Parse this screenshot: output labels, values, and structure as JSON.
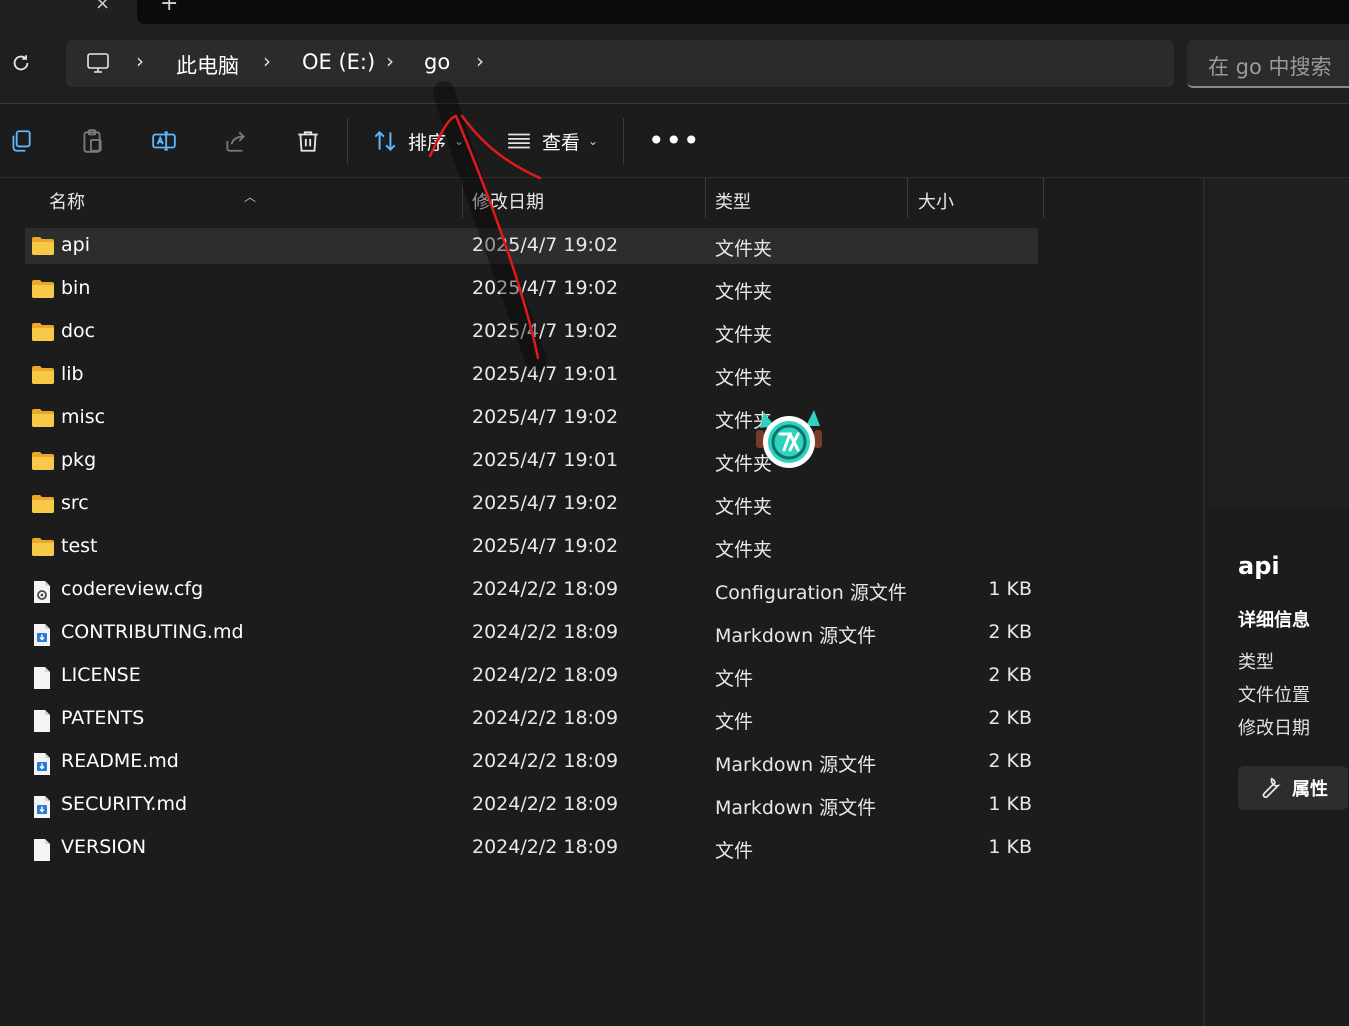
{
  "tabstrip": {
    "close_glyph": "×",
    "add_glyph": "+"
  },
  "navbar": {
    "breadcrumb": [
      "此电脑",
      "OE (E:)",
      "go"
    ],
    "search_placeholder": "在 go 中搜索"
  },
  "toolbar": {
    "sort_label": "排序",
    "view_label": "查看",
    "more_label": "•••",
    "icons": [
      "copy-icon",
      "paste-icon",
      "rename-icon",
      "share-icon",
      "delete-icon",
      "sort-icon",
      "view-icon",
      "more-icon"
    ]
  },
  "columns": {
    "name": "名称",
    "modified": "修改日期",
    "type": "类型",
    "size": "大小"
  },
  "files": [
    {
      "name": "api",
      "date": "2025/4/7 19:02",
      "type": "文件夹",
      "size": "",
      "icon": "folder-icon"
    },
    {
      "name": "bin",
      "date": "2025/4/7 19:02",
      "type": "文件夹",
      "size": "",
      "icon": "folder-icon"
    },
    {
      "name": "doc",
      "date": "2025/4/7 19:02",
      "type": "文件夹",
      "size": "",
      "icon": "folder-icon"
    },
    {
      "name": "lib",
      "date": "2025/4/7 19:01",
      "type": "文件夹",
      "size": "",
      "icon": "folder-icon"
    },
    {
      "name": "misc",
      "date": "2025/4/7 19:02",
      "type": "文件夹",
      "size": "",
      "icon": "folder-icon"
    },
    {
      "name": "pkg",
      "date": "2025/4/7 19:01",
      "type": "文件夹",
      "size": "",
      "icon": "folder-icon"
    },
    {
      "name": "src",
      "date": "2025/4/7 19:02",
      "type": "文件夹",
      "size": "",
      "icon": "folder-icon"
    },
    {
      "name": "test",
      "date": "2025/4/7 19:02",
      "type": "文件夹",
      "size": "",
      "icon": "folder-icon"
    },
    {
      "name": "codereview.cfg",
      "date": "2024/2/2 18:09",
      "type": "Configuration 源文件",
      "size": "1 KB",
      "icon": "config-file-icon"
    },
    {
      "name": "CONTRIBUTING.md",
      "date": "2024/2/2 18:09",
      "type": "Markdown 源文件",
      "size": "2 KB",
      "icon": "markdown-file-icon"
    },
    {
      "name": "LICENSE",
      "date": "2024/2/2 18:09",
      "type": "文件",
      "size": "2 KB",
      "icon": "file-icon"
    },
    {
      "name": "PATENTS",
      "date": "2024/2/2 18:09",
      "type": "文件",
      "size": "2 KB",
      "icon": "file-icon"
    },
    {
      "name": "README.md",
      "date": "2024/2/2 18:09",
      "type": "Markdown 源文件",
      "size": "2 KB",
      "icon": "markdown-file-icon"
    },
    {
      "name": "SECURITY.md",
      "date": "2024/2/2 18:09",
      "type": "Markdown 源文件",
      "size": "1 KB",
      "icon": "markdown-file-icon"
    },
    {
      "name": "VERSION",
      "date": "2024/2/2 18:09",
      "type": "文件",
      "size": "1 KB",
      "icon": "file-icon"
    }
  ],
  "selected_row": 0,
  "details": {
    "title": "api",
    "section": "详细信息",
    "fields": [
      "类型",
      "文件位置",
      "修改日期"
    ],
    "properties_button": "属性"
  },
  "colors": {
    "folder": "#f7c948",
    "selection": "#2d2d2d",
    "annotation": "#e01a1a",
    "accent_mascot": "#2ed3c0"
  }
}
